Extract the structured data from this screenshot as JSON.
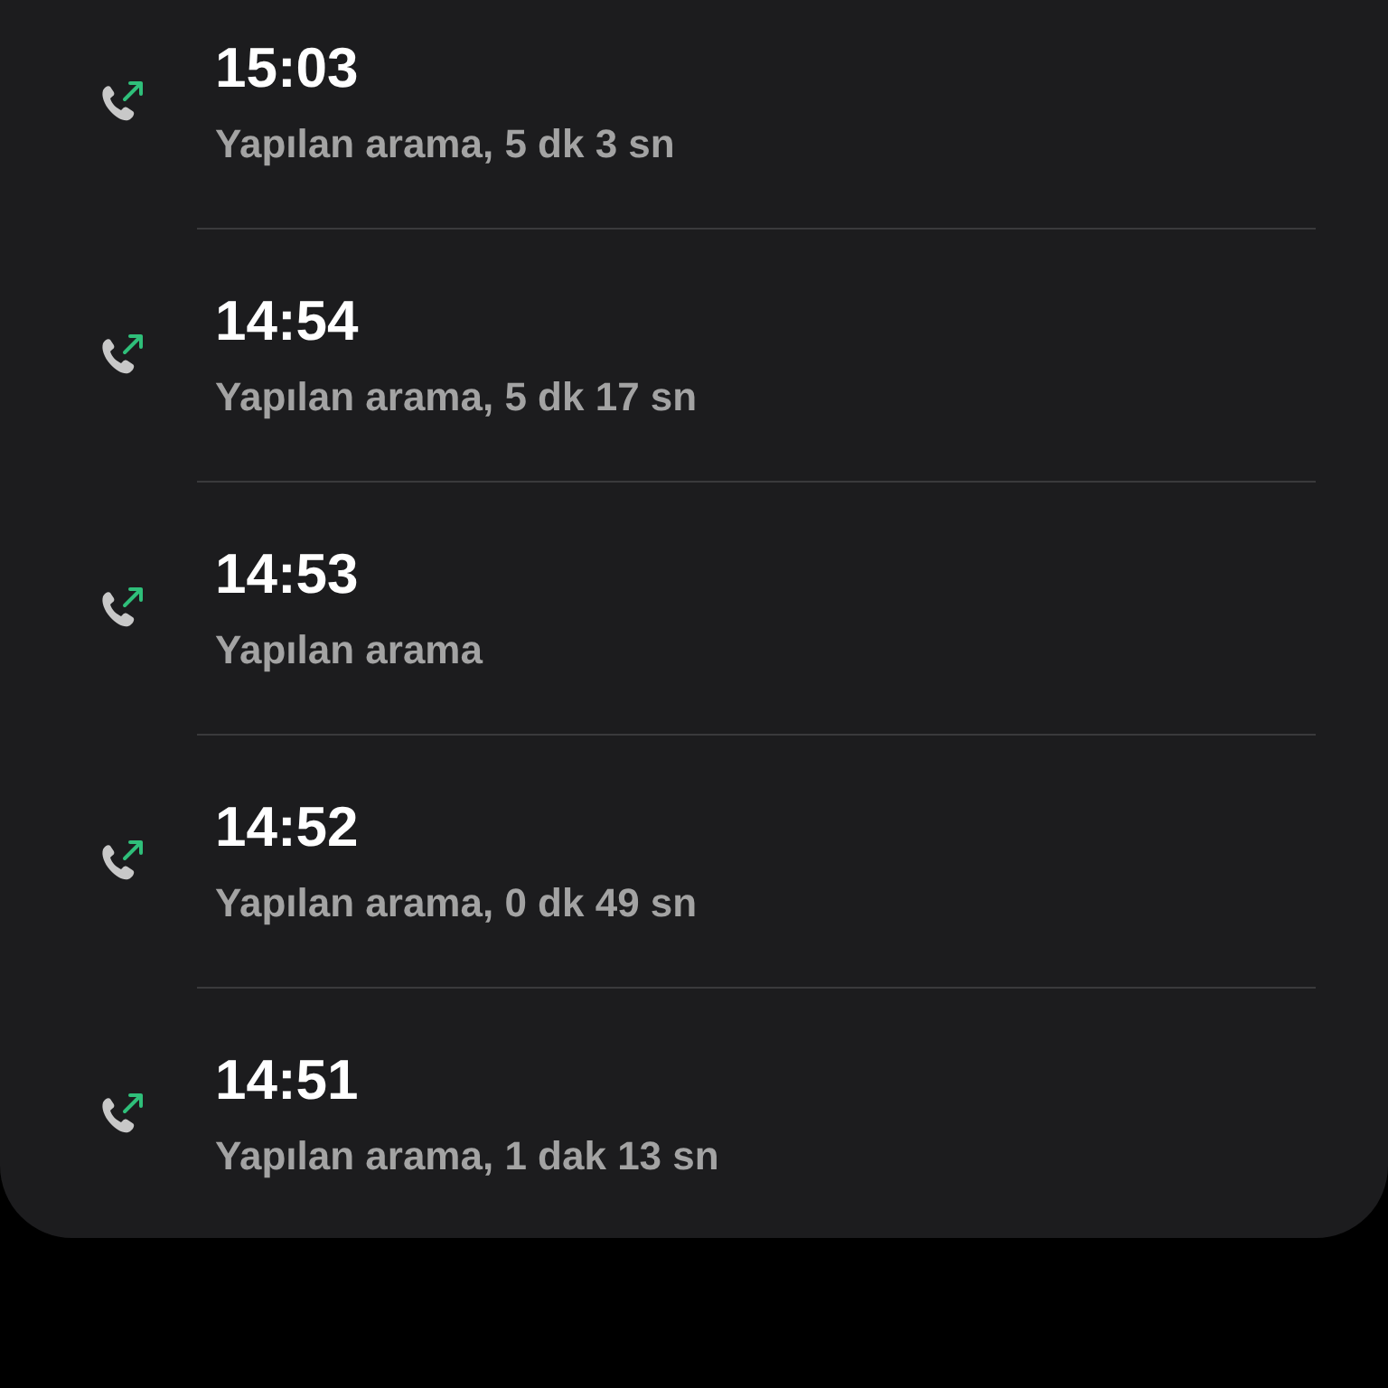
{
  "calls": [
    {
      "kind": "outgoing",
      "time": "15:03",
      "detail": "Yapılan arama, 5 dk 3 sn"
    },
    {
      "kind": "outgoing",
      "time": "14:54",
      "detail": "Yapılan arama, 5 dk 17 sn"
    },
    {
      "kind": "outgoing",
      "time": "14:53",
      "detail": "Yapılan arama"
    },
    {
      "kind": "outgoing",
      "time": "14:52",
      "detail": "Yapılan arama, 0 dk 49 sn"
    },
    {
      "kind": "outgoing",
      "time": "14:51",
      "detail": "Yapılan arama, 1 dak 13 sn"
    }
  ]
}
